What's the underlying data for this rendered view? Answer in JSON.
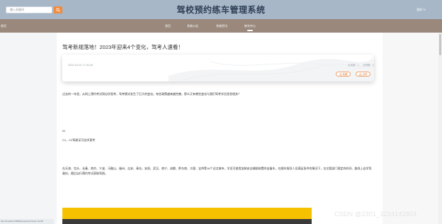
{
  "header": {
    "search_placeholder": "输入关键词",
    "site_title": "驾校预约练车管理系统",
    "user_label": "我的"
  },
  "nav": {
    "left_label": "首页",
    "items": [
      {
        "label": "首页"
      },
      {
        "label": "系统公告"
      },
      {
        "label": "系统资讯"
      },
      {
        "label": "练车中心"
      }
    ]
  },
  "article": {
    "title": "驾考新规落地！2023年迎来4个变化，驾考人速看！",
    "date": "2023-04-02 17:52:45",
    "views_label": "点击数：1",
    "likes_label": "点赞数：0",
    "collect_label": "收藏",
    "like_label": "点赞",
    "intro": "过去的一年里，从网上预约考试到自学直考，驾考模式发生了巨大的变化。有些政策越来越完善，那么又有哪些变化与我们驾考学员息息相关？",
    "section_number": "01",
    "section_heading": "C1、C2驾驶证可自学直考",
    "section_body": "在天津、包头、长春、南京、宁波、马鞍山、福州、吉安、青岛、安阳、武汉、南宁、成都、黔东南、大理、宝鸡等16个试点城市，学员可使用加装安全辅助装置的自备车，在随车指导人员满足条件的情况下，在交管部门规定的时间、路线上自学驾驶技，随后自行预约考试获取驾照。"
  },
  "watermark": "CSDN @2301_3224142804",
  "status_bar": "http://localhost:8080/jiaxiao/front/index.html#/"
}
